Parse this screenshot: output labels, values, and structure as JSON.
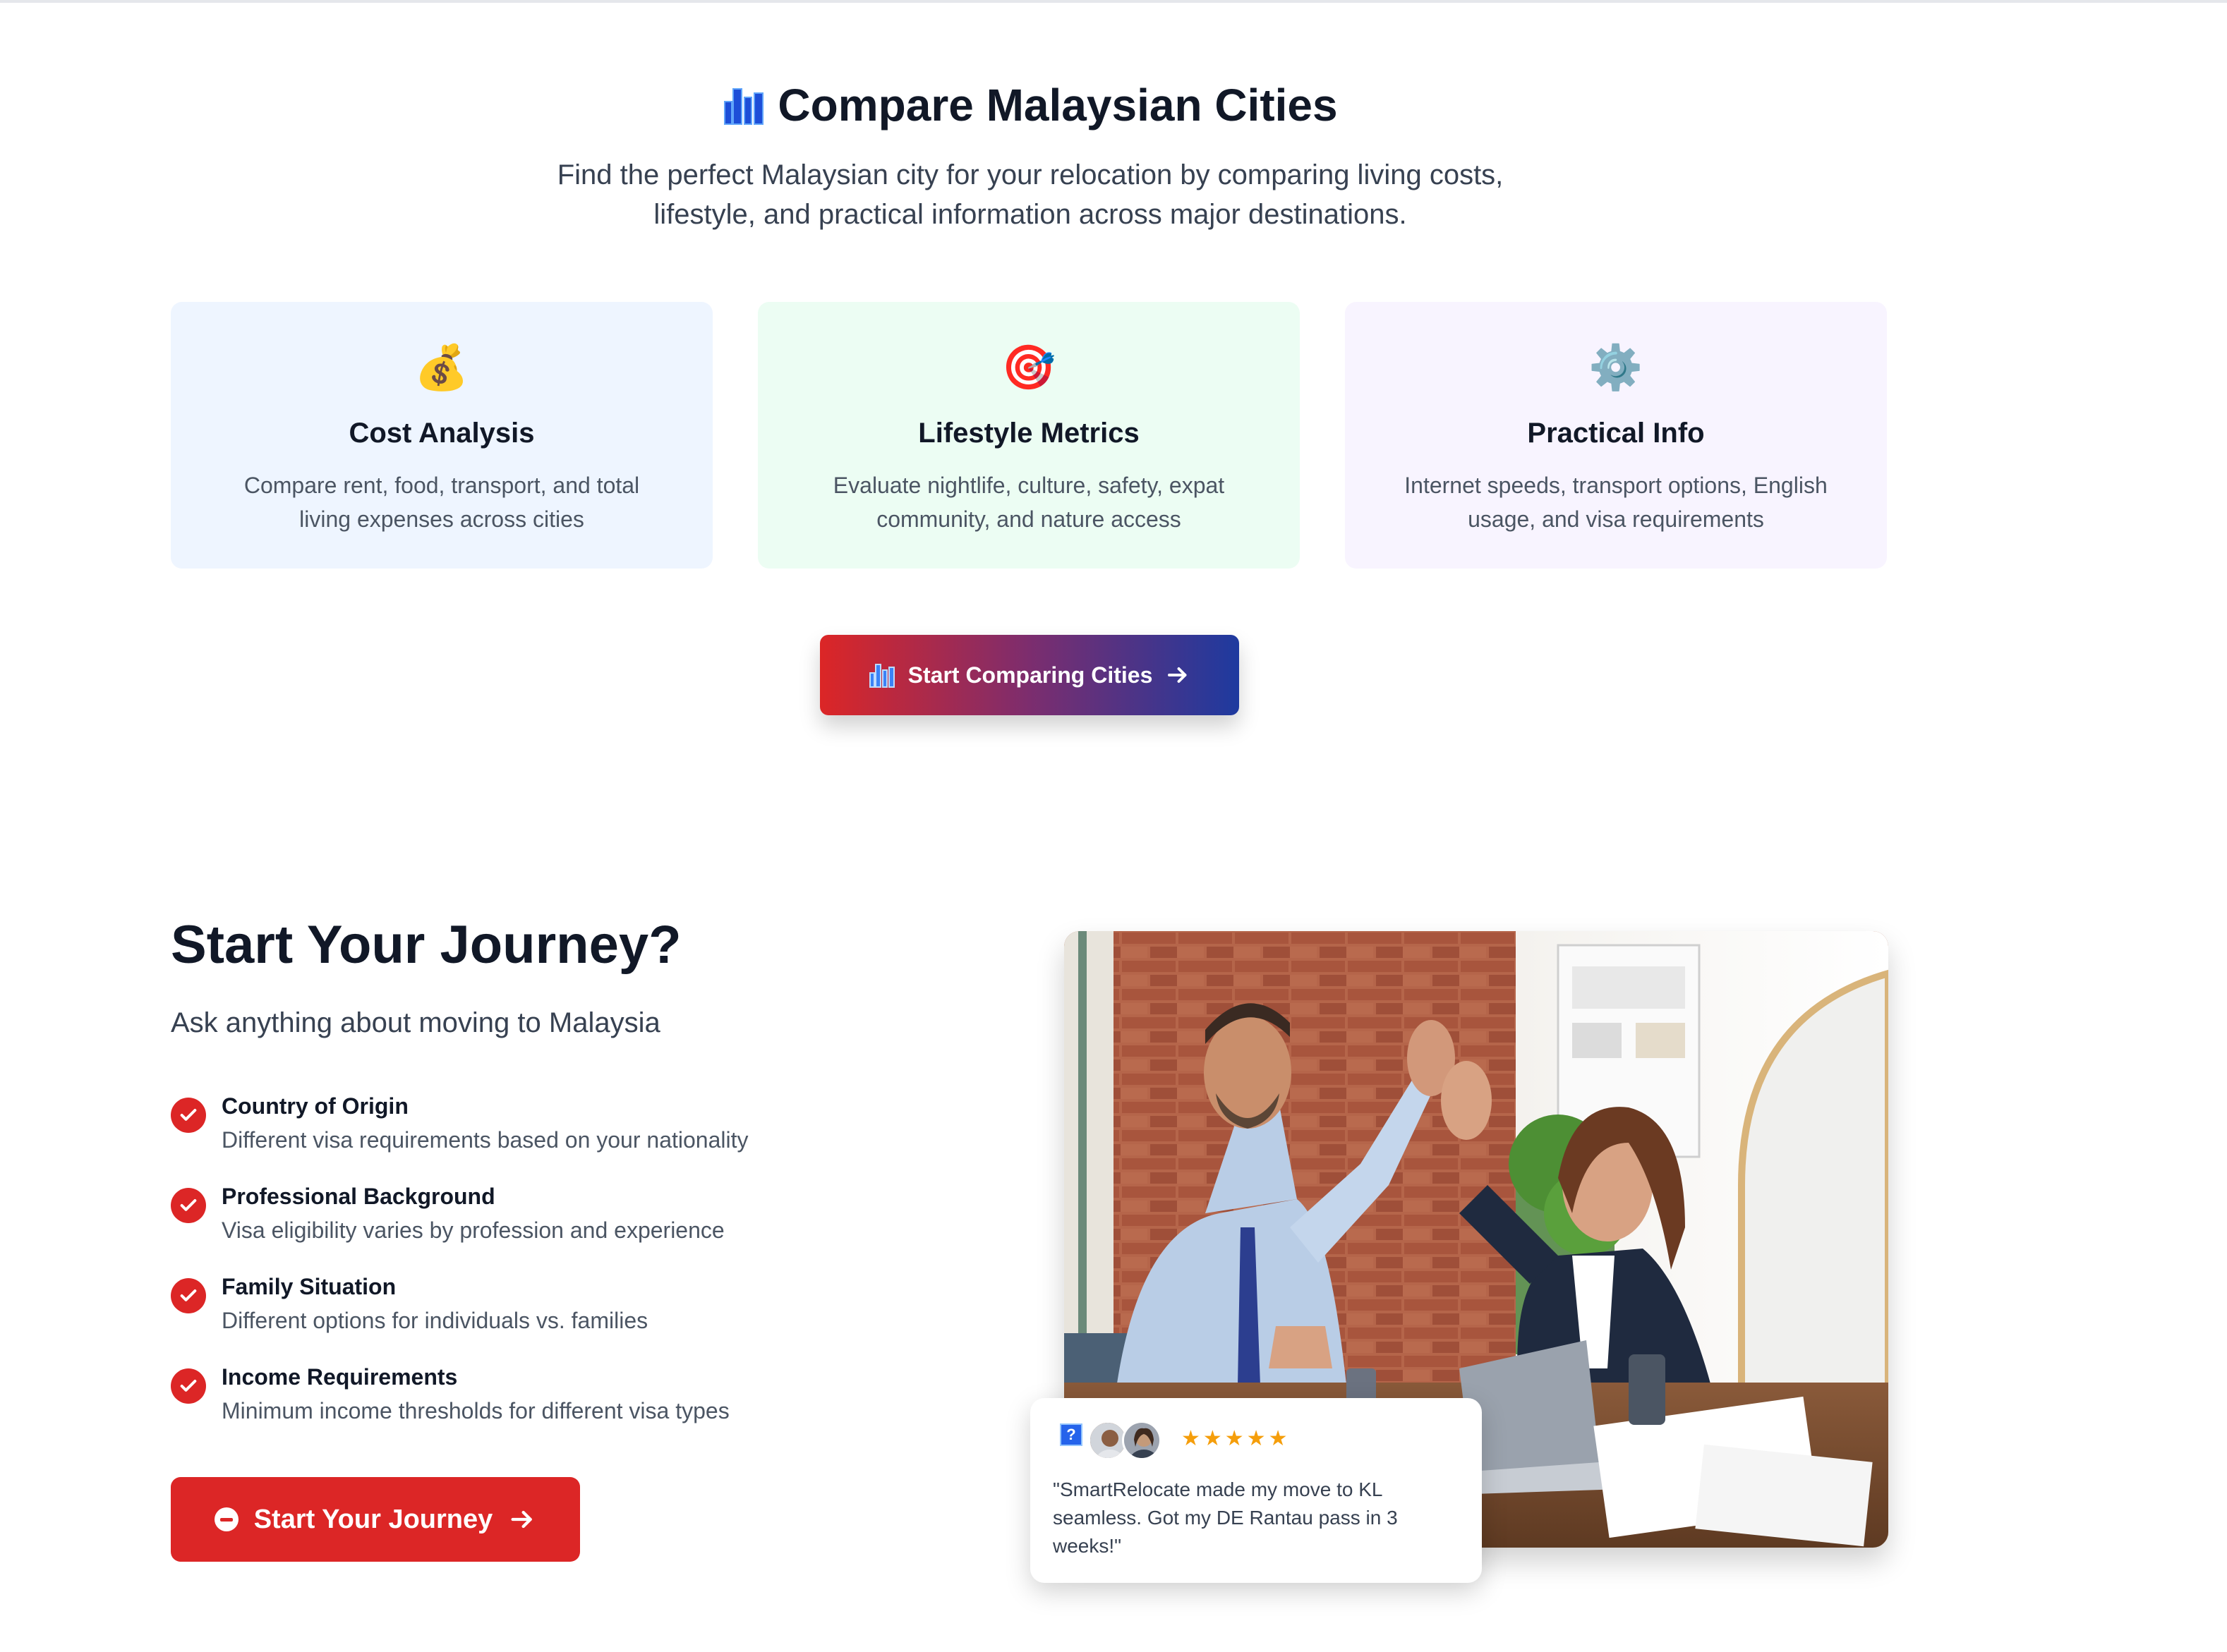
{
  "compare": {
    "title": "Compare Malaysian Cities",
    "subtitle_line1": "Find the perfect Malaysian city for your relocation by comparing living costs,",
    "subtitle_line2": "lifestyle, and practical information across major destinations.",
    "cards": [
      {
        "icon": "money-bag-icon",
        "glyph": "💰",
        "title": "Cost Analysis",
        "desc_line1": "Compare rent, food, transport, and total",
        "desc_line2": "living expenses across cities",
        "bg": "#eef5ff"
      },
      {
        "icon": "target-icon",
        "glyph": "🎯",
        "title": "Lifestyle Metrics",
        "desc_line1": "Evaluate nightlife, culture, safety, expat",
        "desc_line2": "community, and nature access",
        "bg": "#ecfdf3"
      },
      {
        "icon": "gear-icon",
        "glyph": "⚙️",
        "title": "Practical Info",
        "desc_line1": "Internet speeds, transport options, English",
        "desc_line2": "usage, and visa requirements",
        "bg": "#f8f4ff"
      }
    ],
    "button_label": "Start Comparing Cities"
  },
  "journey": {
    "title": "Start Your Journey?",
    "subtitle": "Ask anything about moving to Malaysia",
    "features": [
      {
        "title": "Country of Origin",
        "desc": "Different visa requirements based on your nationality"
      },
      {
        "title": "Professional Background",
        "desc": "Visa eligibility varies by profession and experience"
      },
      {
        "title": "Family Situation",
        "desc": "Different options for individuals vs. families"
      },
      {
        "title": "Income Requirements",
        "desc": "Minimum income thresholds for different visa types"
      }
    ],
    "button_label": "Start Your Journey"
  },
  "testimonial": {
    "rating": 5,
    "stars": "★★★★★",
    "quote_line1": "\"SmartRelocate made my move to KL",
    "quote_line2": "seamless. Got my DE Rantau pass in 3",
    "quote_line3": "weeks!\""
  },
  "colors": {
    "brand_red": "#dc2626",
    "brand_blue": "#1e3a9f",
    "star": "#f59e0b"
  }
}
